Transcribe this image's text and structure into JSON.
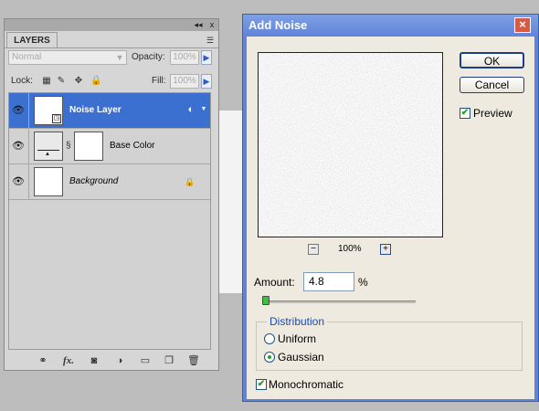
{
  "layers_panel": {
    "collapse_glyph": "◂◂",
    "close_glyph": "x",
    "menu_glyph": "☰",
    "tab_label": "LAYERS",
    "blend_mode": "Normal",
    "opacity_label": "Opacity:",
    "opacity_value": "100%",
    "lock_label": "Lock:",
    "fill_label": "Fill:",
    "fill_value": "100%",
    "layers": [
      {
        "name": "Noise Layer",
        "selected": true
      },
      {
        "name": "Base Color",
        "selected": false
      },
      {
        "name": "Background",
        "selected": false,
        "locked": true
      }
    ],
    "bottom_icons": [
      "link-icon",
      "fx-icon",
      "mask-icon",
      "adjustment-icon",
      "group-icon",
      "new-layer-icon",
      "trash-icon"
    ],
    "bottom_fx_text": "fx."
  },
  "dialog": {
    "title": "Add Noise",
    "close_glyph": "×",
    "ok_label": "OK",
    "cancel_label": "Cancel",
    "preview_label": "Preview",
    "preview_checked": true,
    "zoom_out_glyph": "−",
    "zoom_in_glyph": "+",
    "zoom_level": "100%",
    "amount_label": "Amount:",
    "amount_value": "4.8",
    "amount_unit": "%",
    "amount_slider_fraction": 0.02,
    "distribution_label": "Distribution",
    "uniform_label": "Uniform",
    "gaussian_label": "Gaussian",
    "selected_distribution": "Gaussian",
    "monochromatic_label": "Monochromatic",
    "monochromatic_checked": true
  },
  "colors": {
    "selection_blue": "#3b6fd0",
    "title_blue": "#5f83d9",
    "dialog_bg": "#eeeae0",
    "check_green": "#21a121",
    "close_red": "#d75a43"
  }
}
